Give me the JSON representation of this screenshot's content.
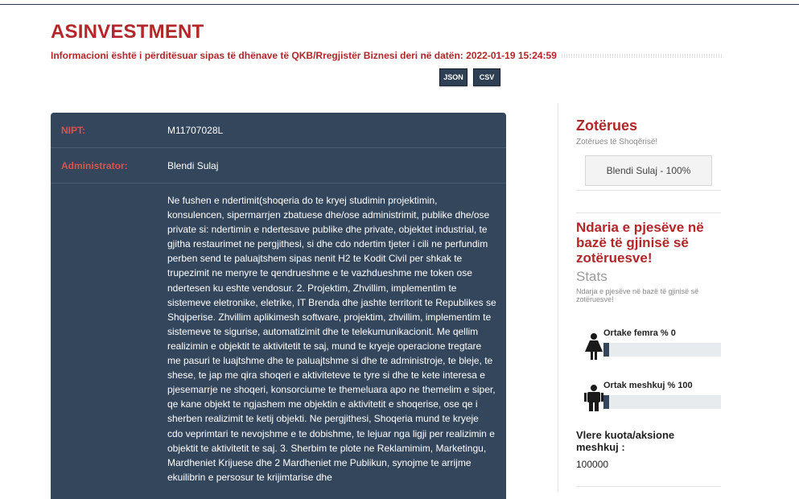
{
  "company": {
    "name": "ASINVESTMENT",
    "update_note": "Informacioni është i përditësuar sipas të dhënave të QKB/Rregjistër Biznesi deri në datën: 2022-01-19 15:24:59"
  },
  "downloads": {
    "json_label": "JSON",
    "csv_label": "CSV"
  },
  "info": {
    "nipt_label": "NIPT:",
    "nipt_value": "M11707028L",
    "admin_label": "Administrator:",
    "admin_value": "Blendi Sulaj",
    "activity_text": "Ne fushen e ndertimit(shoqeria do te kryej studimin projektimin, konsulencen, sipermarrjen zbatuese dhe/ose administrimit, publike dhe/ose private si: ndertimin e ndertesave publike dhe private, objektet industrial, te gjitha restaurimet ne pergjithesi, si dhe cdo ndertim tjeter i cili ne perfundim perben send te paluajtshem sipas nenit H2 te Kodit Civil per shkak te trupezimit ne menyre te qendrueshme e te vazhdueshme me token ose ndertesen ku eshte vendosur. 2. Projektim, Zhvillim, implementim te sistemeve eletronike, eletrike, IT Brenda dhe jashte territorit te Republikes se Shqiperise. Zhvillim aplikimesh software, projektim, zhvillim, implementim te sistemeve te sigurise, automatizimit dhe te telekumunikacionit. Me qellim realizimin e objektit te aktivitetit te saj, mund te kryeje operacione tregtare me pasuri te luajtshme dhe te paluajtshme si dhe te administroje, te bleje, te shese, te jap me qira shoqeri e aktiviteteve te tyre si dhe te kete interesa e pjesemarrje ne shoqeri, konsorciume te themeluara apo ne themelim e siper, qe kane objekt te ngjashem me objektin e aktivitetit e shoqerise, ose qe i sherben realizimit te ketij objekti. Ne pergjithesi, Shoqeria mund te kryeje cdo veprimtari te nevojshme e te dobishme, te lejuar nga ligji per realizimin e objektit te aktivitetit te saj. 3. Sherbim te plote ne Reklamimim, Marketingu, Mardheniet Krijuese dhe 2 Mardheniet me Publikun, synojme te arrijme ekuilibrin e persosur te krijimtarise dhe"
  },
  "owners": {
    "title": "Zotërues",
    "subtitle": "Zotërues të Shoqërisë!",
    "items": [
      "Blendi Sulaj - 100%"
    ]
  },
  "gender": {
    "title": "Ndaria e pjesëve në bazë të gjinisë së zotëruesve!",
    "stats_label": "Stats",
    "subtitle": "Ndarja e pjesëve në bazë të gjinisë së zotëruesve!",
    "female_label": "Ortake femra % 0",
    "female_percent": 0,
    "male_label": "Ortak meshkuj % 100",
    "male_percent": 100,
    "kuota_label": "Vlere kuota/aksione meshkuj :",
    "kuota_value": "100000"
  },
  "colors": {
    "brand_red": "#b3262a",
    "panel_navy": "#34465b",
    "label_red": "#d9534f"
  },
  "icons": [
    "female-person-icon",
    "male-person-icon"
  ]
}
